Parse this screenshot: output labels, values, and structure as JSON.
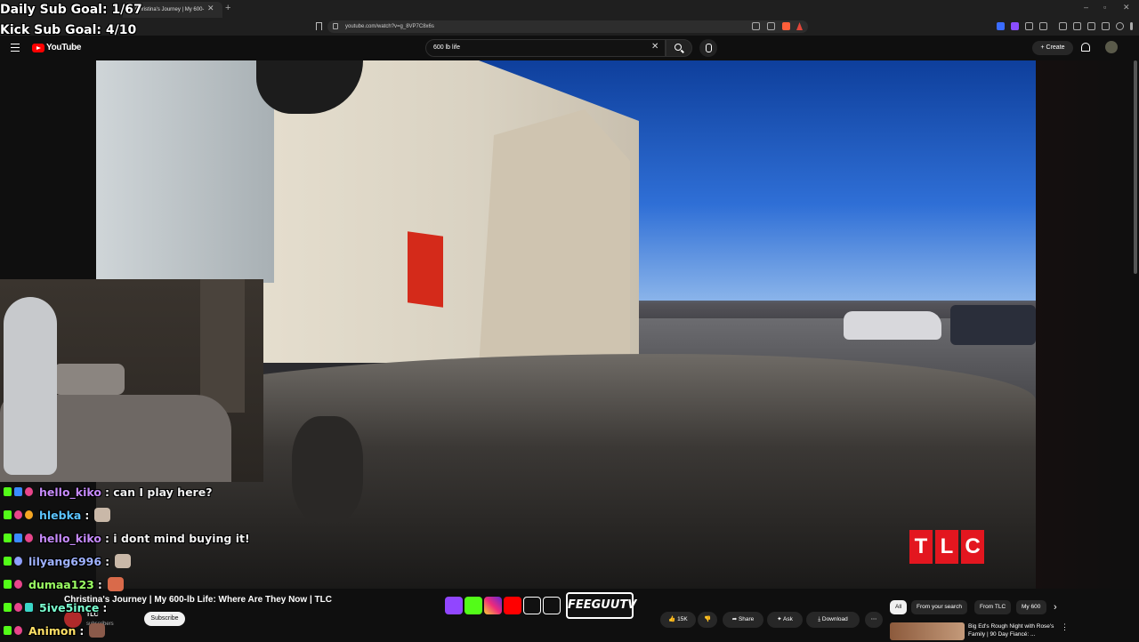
{
  "browser": {
    "tab_title": "Christina's Journey | My 600-",
    "url": "youtube.com/watch?v=g_8VP7C8x6s"
  },
  "youtube": {
    "logo_text": "YouTube",
    "search_value": "600 lb life",
    "create_label": "Create"
  },
  "overlay": {
    "daily_goal": "Daily Sub Goal: 1/67",
    "kick_goal": "Kick Sub Goal: 4/10",
    "tlc_letters": [
      "T",
      "L",
      "C"
    ],
    "streamer_brand": "FEEGUUTV"
  },
  "chat": [
    {
      "user": "hello_kiko",
      "message": ": can I play here?",
      "color": "#c58af9"
    },
    {
      "user": "hlebka",
      "message": ":",
      "color": "#5bc4ff",
      "emote": true
    },
    {
      "user": "hello_kiko",
      "message": ": i dont mind buying it!",
      "color": "#c58af9"
    },
    {
      "user": "lilyang6996",
      "message": ":",
      "color": "#9fb2ff",
      "emote": true
    },
    {
      "user": "dumaa123",
      "message": ":",
      "color": "#9bff63",
      "emote": true
    },
    {
      "user": "5ive5ince",
      "message": ":",
      "color": "#7affd0",
      "emote": true
    },
    {
      "user": "Animon",
      "message": ":",
      "color": "#ffe066",
      "emote": true
    }
  ],
  "video_info": {
    "title": "Christina's Journey | My 600-lb Life: Where Are They Now | TLC",
    "channel": "TLC",
    "subscribers": "subscribers",
    "subscribe_label": "Subscribe",
    "likes": "15K",
    "share_label": "Share",
    "ask_label": "Ask",
    "download_label": "Download"
  },
  "sidebar": {
    "chips": [
      "All",
      "From your search",
      "From TLC",
      "My 600"
    ],
    "rec_title": "Big Ed's Rough Night with Rose's Family | 90 Day Fiancé: ..."
  }
}
